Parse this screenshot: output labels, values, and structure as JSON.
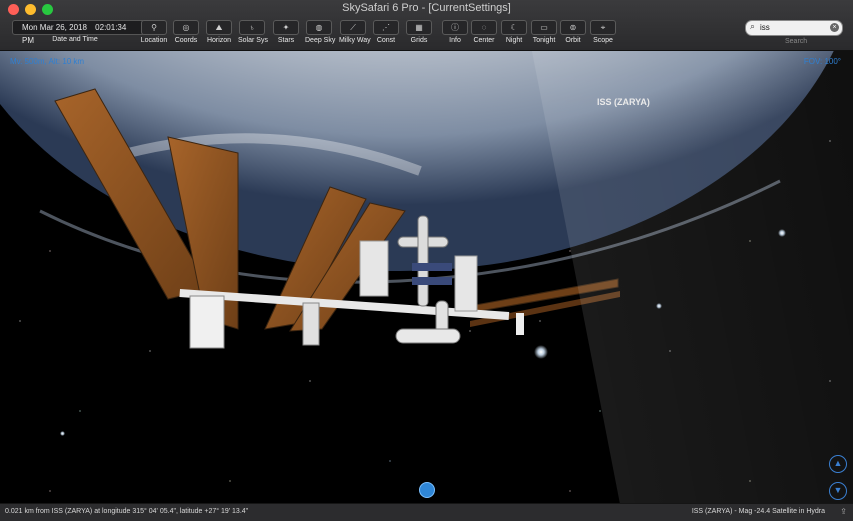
{
  "window": {
    "title": "SkySafari 6 Pro - [CurrentSettings]"
  },
  "toolbar": {
    "date": "Mon Mar 26, 2018",
    "time": "02:01:34 PM",
    "items": [
      {
        "label": "Date and Time",
        "icon": "calendar-icon"
      },
      {
        "label": "Location",
        "icon": "location-pin-icon"
      },
      {
        "label": "Coords",
        "icon": "coords-icon"
      },
      {
        "label": "Horizon",
        "icon": "horizon-icon"
      },
      {
        "label": "Solar Sys",
        "icon": "planet-icon"
      },
      {
        "label": "Stars",
        "icon": "stars-icon"
      },
      {
        "label": "Deep Sky",
        "icon": "galaxy-icon"
      },
      {
        "label": "Milky Way",
        "icon": "milky-way-icon"
      },
      {
        "label": "Const",
        "icon": "constellation-icon"
      },
      {
        "label": "Grids",
        "icon": "grid-icon"
      },
      {
        "label": "Info",
        "icon": "info-icon"
      },
      {
        "label": "Center",
        "icon": "center-icon"
      },
      {
        "label": "Night",
        "icon": "moon-icon"
      },
      {
        "label": "Tonight",
        "icon": "tonight-icon"
      },
      {
        "label": "Orbit",
        "icon": "orbit-icon"
      },
      {
        "label": "Scope",
        "icon": "telescope-icon"
      }
    ],
    "search": {
      "value": "iss",
      "label": "Search"
    }
  },
  "view": {
    "object_label": "ISS (ZARYA)",
    "corner_left": "Mv. 500m, Alt: 10 km",
    "corner_right": "FOV: 100°"
  },
  "status": {
    "left": "0.021 km from ISS (ZARYA) at longitude 315° 04' 05.4\", latitude +27° 19' 13.4\"",
    "right": "ISS (ZARYA) - Mag -24.4 Satellite in Hydra"
  }
}
